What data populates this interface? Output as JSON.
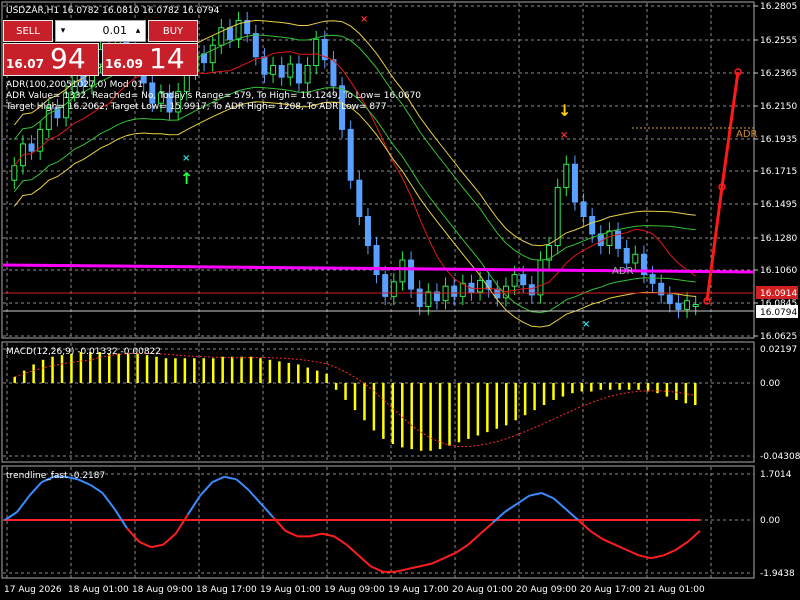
{
  "header": {
    "symbol_line": "USDZAR,H1  16.0782 16.0810 16.0782 16.0794"
  },
  "trade_panel": {
    "sell_label": "SELL",
    "buy_label": "BUY",
    "lot_value": "0.01",
    "sell_price_small": "16.07",
    "sell_price_big": "94",
    "buy_price_small": "16.09",
    "buy_price_big": "14"
  },
  "indicator_text": {
    "line1": "ADR(100,20051027,0) Mod 01",
    "line2": "ADR Value= 1332, Reached= No, Today's Range= 579, To High= 16.1249, To Low= 16.0670",
    "line3": "Target High= 16.2062, Target Low= 15.9917, To ADR High= 1208, To ADR Low= 877"
  },
  "price_axis": {
    "ticks": [
      "16.2805",
      "16.2555",
      "16.2365",
      "16.2150",
      "16.1935",
      "16.1715",
      "16.1495",
      "16.1280",
      "16.1060",
      "16.0845",
      "16.0625"
    ],
    "bid_label": "16.0914",
    "current_label": "16.0794",
    "adr_label": "ADR",
    "adr_mid_label": "ADR"
  },
  "macd_panel": {
    "title": "MACD(12,26,9) -0.01332 -0.00822",
    "ticks": [
      "0.02197",
      "0.00",
      "-0.04308"
    ]
  },
  "trend_panel": {
    "title": "trendline_fast -0.2187",
    "ticks": [
      "1.7014",
      "0.00",
      "-1.9438"
    ]
  },
  "time_axis": {
    "labels": [
      "17 Aug 2026",
      "18 Aug 01:00",
      "18 Aug 09:00",
      "18 Aug 17:00",
      "19 Aug 01:00",
      "19 Aug 09:00",
      "19 Aug 17:00",
      "20 Aug 01:00",
      "20 Aug 09:00",
      "20 Aug 17:00",
      "21 Aug 01:00"
    ]
  },
  "colors": {
    "background": "#000000",
    "grid": "#8c8c8c",
    "bull": "#2eea52",
    "bear": "#5aa0ff",
    "pivot": "#ff00ff",
    "envelope": "#e8d044",
    "bollinger": "#34c234",
    "ma": "#e01818",
    "macd_hist": "#ffff00",
    "macd_signal": "#ff2b2b",
    "trend_up": "#3b8bff",
    "trend_down": "#ff1e1e",
    "trade_red": "#c8202a"
  },
  "chart_data": {
    "type": "candlestick",
    "symbol": "USDZAR",
    "timeframe": "H1",
    "last_bar": {
      "open": 16.0782,
      "high": 16.081,
      "low": 16.0782,
      "close": 16.0794
    },
    "price_range": [
      16.057,
      16.285
    ],
    "pivot_level": 16.1045,
    "bid_line": 16.0914,
    "ask_line": 16.0794,
    "candles": [
      {
        "o": 16.165,
        "c": 16.175
      },
      {
        "o": 16.175,
        "c": 16.19
      },
      {
        "o": 16.19,
        "c": 16.185
      },
      {
        "o": 16.185,
        "c": 16.2
      },
      {
        "o": 16.2,
        "c": 16.215
      },
      {
        "o": 16.215,
        "c": 16.208
      },
      {
        "o": 16.208,
        "c": 16.225
      },
      {
        "o": 16.225,
        "c": 16.238
      },
      {
        "o": 16.238,
        "c": 16.23
      },
      {
        "o": 16.23,
        "c": 16.245
      },
      {
        "o": 16.245,
        "c": 16.255
      },
      {
        "o": 16.255,
        "c": 16.248
      },
      {
        "o": 16.248,
        "c": 16.262
      },
      {
        "o": 16.262,
        "c": 16.255
      },
      {
        "o": 16.255,
        "c": 16.245
      },
      {
        "o": 16.245,
        "c": 16.232
      },
      {
        "o": 16.232,
        "c": 16.218
      },
      {
        "o": 16.218,
        "c": 16.225
      },
      {
        "o": 16.225,
        "c": 16.212
      },
      {
        "o": 16.212,
        "c": 16.226
      },
      {
        "o": 16.226,
        "c": 16.24
      },
      {
        "o": 16.24,
        "c": 16.252
      },
      {
        "o": 16.252,
        "c": 16.246
      },
      {
        "o": 16.246,
        "c": 16.258
      },
      {
        "o": 16.258,
        "c": 16.27
      },
      {
        "o": 16.27,
        "c": 16.262
      },
      {
        "o": 16.262,
        "c": 16.275
      },
      {
        "o": 16.275,
        "c": 16.266
      },
      {
        "o": 16.266,
        "c": 16.25
      },
      {
        "o": 16.25,
        "c": 16.238
      },
      {
        "o": 16.238,
        "c": 16.244
      },
      {
        "o": 16.244,
        "c": 16.236
      },
      {
        "o": 16.236,
        "c": 16.245
      },
      {
        "o": 16.245,
        "c": 16.232
      },
      {
        "o": 16.232,
        "c": 16.244
      },
      {
        "o": 16.244,
        "c": 16.262
      },
      {
        "o": 16.262,
        "c": 16.248
      },
      {
        "o": 16.248,
        "c": 16.23
      },
      {
        "o": 16.23,
        "c": 16.2
      },
      {
        "o": 16.2,
        "c": 16.165
      },
      {
        "o": 16.165,
        "c": 16.14
      },
      {
        "o": 16.14,
        "c": 16.12
      },
      {
        "o": 16.12,
        "c": 16.1
      },
      {
        "o": 16.1,
        "c": 16.085
      },
      {
        "o": 16.085,
        "c": 16.095
      },
      {
        "o": 16.095,
        "c": 16.11
      },
      {
        "o": 16.11,
        "c": 16.09
      },
      {
        "o": 16.09,
        "c": 16.078
      },
      {
        "o": 16.078,
        "c": 16.088
      },
      {
        "o": 16.088,
        "c": 16.082
      },
      {
        "o": 16.082,
        "c": 16.092
      },
      {
        "o": 16.092,
        "c": 16.085
      },
      {
        "o": 16.085,
        "c": 16.094
      },
      {
        "o": 16.094,
        "c": 16.088
      },
      {
        "o": 16.088,
        "c": 16.096
      },
      {
        "o": 16.096,
        "c": 16.09
      },
      {
        "o": 16.09,
        "c": 16.084
      },
      {
        "o": 16.084,
        "c": 16.092
      },
      {
        "o": 16.092,
        "c": 16.1
      },
      {
        "o": 16.1,
        "c": 16.093
      },
      {
        "o": 16.093,
        "c": 16.086
      },
      {
        "o": 16.086,
        "c": 16.11
      },
      {
        "o": 16.11,
        "c": 16.12
      },
      {
        "o": 16.12,
        "c": 16.16
      },
      {
        "o": 16.16,
        "c": 16.176
      },
      {
        "o": 16.176,
        "c": 16.15
      },
      {
        "o": 16.15,
        "c": 16.14
      },
      {
        "o": 16.14,
        "c": 16.128
      },
      {
        "o": 16.128,
        "c": 16.12
      },
      {
        "o": 16.12,
        "c": 16.13
      },
      {
        "o": 16.13,
        "c": 16.118
      },
      {
        "o": 16.118,
        "c": 16.108
      },
      {
        "o": 16.108,
        "c": 16.114
      },
      {
        "o": 16.114,
        "c": 16.1
      },
      {
        "o": 16.1,
        "c": 16.094
      },
      {
        "o": 16.094,
        "c": 16.086
      },
      {
        "o": 16.086,
        "c": 16.08
      },
      {
        "o": 16.08,
        "c": 16.076
      },
      {
        "o": 16.076,
        "c": 16.082
      },
      {
        "o": 16.078,
        "c": 16.0794
      }
    ],
    "macd_histogram": [
      0.004,
      0.008,
      0.012,
      0.015,
      0.017,
      0.018,
      0.019,
      0.02,
      0.02,
      0.02,
      0.019,
      0.019,
      0.019,
      0.019,
      0.018,
      0.017,
      0.016,
      0.016,
      0.016,
      0.016,
      0.016,
      0.016,
      0.017,
      0.017,
      0.017,
      0.017,
      0.016,
      0.015,
      0.014,
      0.013,
      0.012,
      0.01,
      0.008,
      0.006,
      -0.004,
      -0.01,
      -0.016,
      -0.022,
      -0.028,
      -0.033,
      -0.036,
      -0.038,
      -0.039,
      -0.04,
      -0.04,
      -0.039,
      -0.037,
      -0.035,
      -0.033,
      -0.031,
      -0.029,
      -0.027,
      -0.025,
      -0.022,
      -0.019,
      -0.016,
      -0.013,
      -0.01,
      -0.008,
      -0.006,
      -0.005,
      -0.005,
      -0.004,
      -0.004,
      -0.004,
      -0.004,
      -0.004,
      -0.005,
      -0.006,
      -0.008,
      -0.01,
      -0.012,
      -0.013
    ],
    "trendline_fast": [
      0.0,
      0.3,
      0.9,
      1.4,
      1.6,
      1.6,
      1.5,
      1.3,
      1.0,
      0.4,
      -0.3,
      -0.8,
      -1.0,
      -0.9,
      -0.5,
      0.2,
      0.9,
      1.4,
      1.6,
      1.5,
      1.1,
      0.6,
      0.1,
      -0.4,
      -0.6,
      -0.6,
      -0.5,
      -0.6,
      -0.9,
      -1.3,
      -1.7,
      -1.9,
      -1.9,
      -1.8,
      -1.7,
      -1.6,
      -1.4,
      -1.2,
      -0.9,
      -0.5,
      -0.1,
      0.3,
      0.6,
      0.9,
      1.0,
      0.8,
      0.4,
      0.0,
      -0.4,
      -0.7,
      -0.9,
      -1.1,
      -1.3,
      -1.4,
      -1.3,
      -1.1,
      -0.8,
      -0.4
    ]
  }
}
